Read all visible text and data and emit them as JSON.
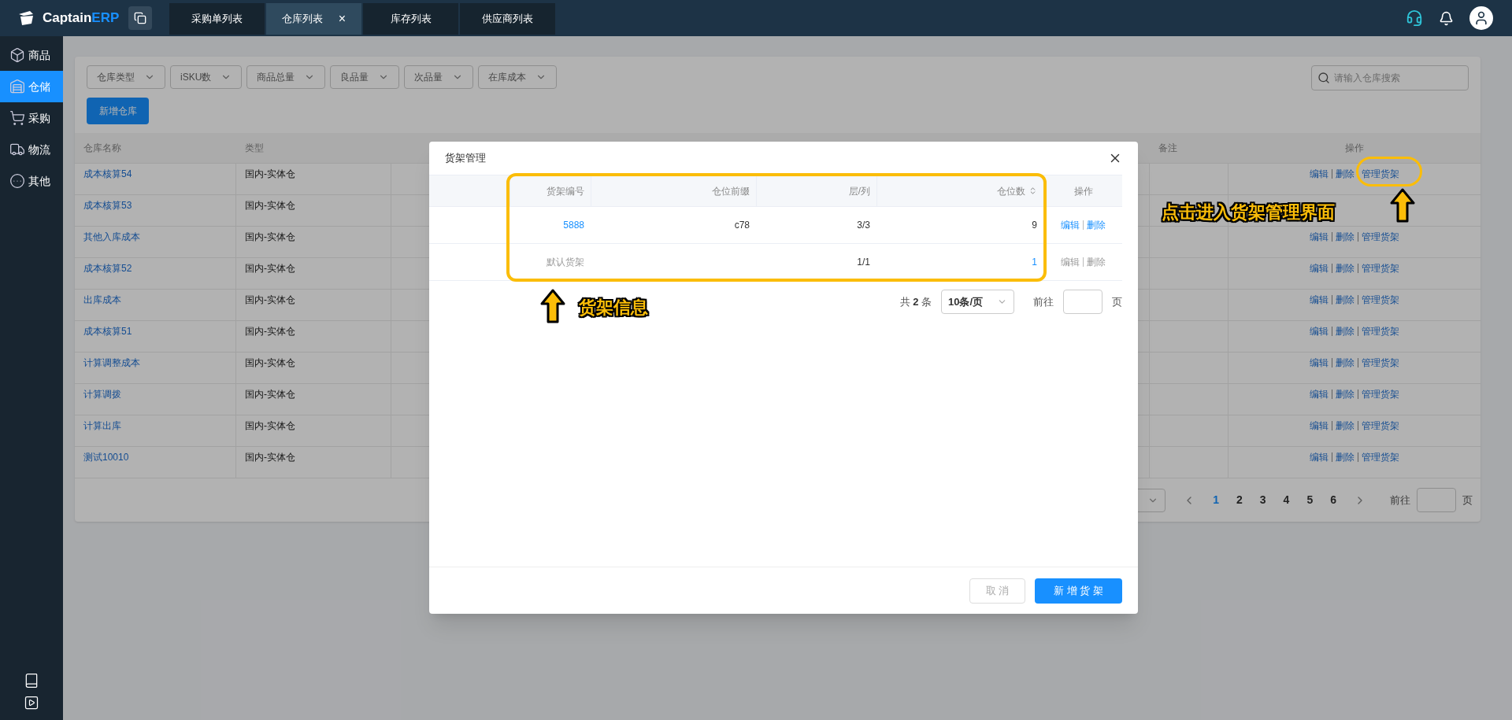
{
  "app": {
    "logo_text": "Captain",
    "logo_accent": "ERP"
  },
  "tabs": [
    {
      "label": "采购单列表",
      "selected": false,
      "closable": false
    },
    {
      "label": "仓库列表",
      "selected": true,
      "closable": true,
      "close_glyph": "×"
    },
    {
      "label": "库存列表",
      "selected": false,
      "closable": false
    },
    {
      "label": "供应商列表",
      "selected": false,
      "closable": false
    }
  ],
  "sidebar": {
    "items": [
      {
        "kind": "box",
        "label": "商品",
        "selected": false
      },
      {
        "kind": "warehouse",
        "label": "仓储",
        "selected": true
      },
      {
        "kind": "cart",
        "label": "采购",
        "selected": false
      },
      {
        "kind": "truck",
        "label": "物流",
        "selected": false
      },
      {
        "kind": "more",
        "label": "其他",
        "selected": false
      }
    ]
  },
  "filters": [
    "仓库类型",
    "iSKU数",
    "商品总量",
    "良品量",
    "次品量",
    "在库成本"
  ],
  "search": {
    "placeholder": "请输入仓库搜索"
  },
  "add_button": "新增仓库",
  "table": {
    "columns": [
      "仓库名称",
      "类型",
      "备注",
      "操作"
    ],
    "rows": [
      {
        "name": "成本核算54",
        "type": "国内-实体仓",
        "actions": [
          "编辑",
          "删除",
          "管理货架"
        ]
      },
      {
        "name": "成本核算53",
        "type": "国内-实体仓",
        "actions": []
      },
      {
        "name": "其他入库成本",
        "type": "国内-实体仓",
        "actions": [
          "编辑",
          "删除",
          "管理货架"
        ]
      },
      {
        "name": "成本核算52",
        "type": "国内-实体仓",
        "actions": [
          "编辑",
          "删除",
          "管理货架"
        ]
      },
      {
        "name": "出库成本",
        "type": "国内-实体仓",
        "actions": [
          "编辑",
          "删除",
          "管理货架"
        ]
      },
      {
        "name": "成本核算51",
        "type": "国内-实体仓",
        "actions": [
          "编辑",
          "删除",
          "管理货架"
        ]
      },
      {
        "name": "计算调整成本",
        "type": "国内-实体仓",
        "actions": [
          "编辑",
          "删除",
          "管理货架"
        ]
      },
      {
        "name": "计算调拨",
        "type": "国内-实体仓",
        "actions": [
          "编辑",
          "删除",
          "管理货架"
        ]
      },
      {
        "name": "计算出库",
        "type": "国内-实体仓",
        "actions": [
          "编辑",
          "删除",
          "管理货架"
        ]
      },
      {
        "name": "测试10010",
        "type": "国内-实体仓",
        "actions": [
          "编辑",
          "删除",
          "管理货架"
        ]
      }
    ]
  },
  "pagination": {
    "pages": [
      {
        "label": "1",
        "selected": true
      },
      {
        "label": "2",
        "selected": false
      },
      {
        "label": "3",
        "selected": false
      },
      {
        "label": "4",
        "selected": false
      },
      {
        "label": "5",
        "selected": false
      },
      {
        "label": "6",
        "selected": false
      }
    ],
    "goto": "前往",
    "unit": "页"
  },
  "dialog": {
    "title": "货架管理",
    "columns": [
      {
        "label": "货架编号",
        "sortable": false
      },
      {
        "label": "仓位前缀",
        "sortable": false
      },
      {
        "label": "层/列",
        "sortable": false
      },
      {
        "label": "仓位数",
        "sortable": true
      },
      {
        "label": "操作",
        "sortable": false
      }
    ],
    "rows": [
      {
        "code": "5888",
        "prefix": "c78",
        "layout": "3/3",
        "slots": "9",
        "editable": true,
        "slots_link": false,
        "actions": [
          "编辑",
          "删除"
        ]
      },
      {
        "code": "默认货架",
        "layout": "1/1",
        "slots": "1",
        "editable": false,
        "slots_link": true,
        "actions": [
          "编辑",
          "删除"
        ]
      }
    ],
    "pagination": {
      "total_prefix": "共",
      "total": "2",
      "total_suffix": "条",
      "page_size": "10条/页",
      "goto": "前往",
      "unit": "页"
    },
    "buttons": [
      {
        "kind": "secondary",
        "label": "取 消"
      },
      {
        "kind": "primary",
        "label": "新 增 货 架"
      }
    ]
  },
  "annotations": [
    {
      "kind": "frame",
      "text": "货架信息"
    },
    {
      "kind": "ring",
      "text": "点击进入货架管理界面"
    }
  ]
}
